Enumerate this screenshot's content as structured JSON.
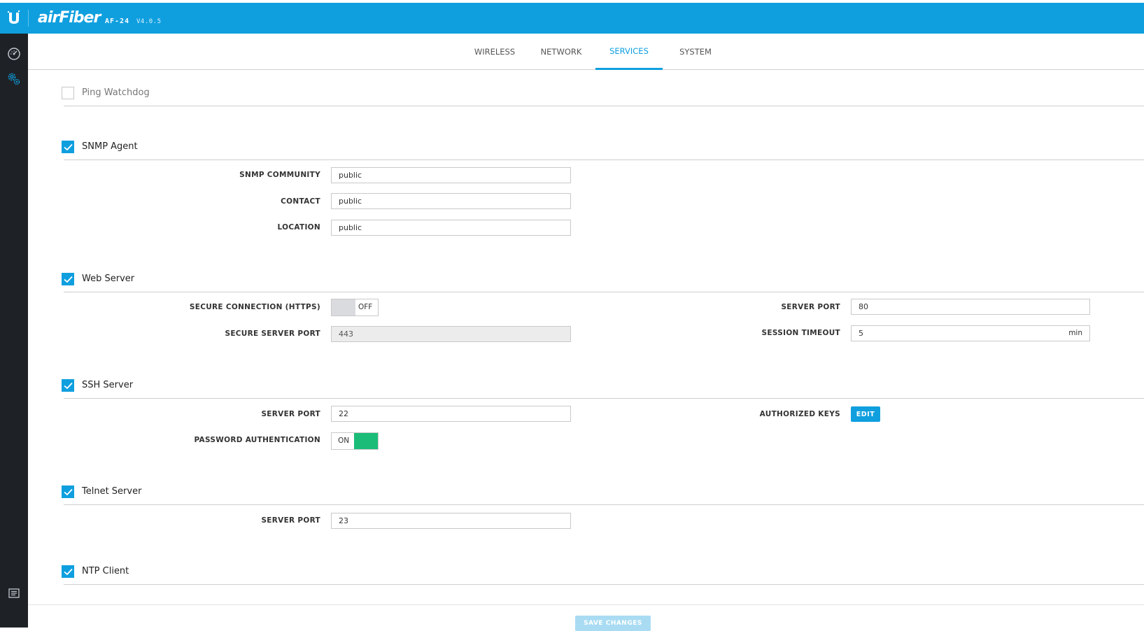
{
  "header": {
    "brand": "airFiber",
    "model": "AF-24",
    "version": "V4.0.5",
    "accent": "#0f9fdf",
    "logo_icon": "ubiquiti-u-icon"
  },
  "sidebar": {
    "items": [
      {
        "name": "dashboard",
        "icon": "dashboard-gauge-icon"
      },
      {
        "name": "settings",
        "icon": "gears-icon"
      },
      {
        "name": "log",
        "icon": "log-list-icon"
      }
    ]
  },
  "tabs": [
    {
      "label": "WIRELESS",
      "active": false
    },
    {
      "label": "NETWORK",
      "active": false
    },
    {
      "label": "SERVICES",
      "active": true
    },
    {
      "label": "SYSTEM",
      "active": false
    }
  ],
  "sections": {
    "ping_watchdog": {
      "title": "Ping Watchdog",
      "checked": false
    },
    "snmp": {
      "title": "SNMP Agent",
      "checked": true,
      "community_label": "SNMP COMMUNITY",
      "community_value": "public",
      "contact_label": "CONTACT",
      "contact_value": "public",
      "location_label": "LOCATION",
      "location_value": "public"
    },
    "web": {
      "title": "Web Server",
      "checked": true,
      "secure_label": "SECURE CONNECTION (HTTPS)",
      "secure_state": "OFF",
      "secure_port_label": "SECURE SERVER PORT",
      "secure_port_value": "443",
      "server_port_label": "SERVER PORT",
      "server_port_value": "80",
      "timeout_label": "SESSION TIMEOUT",
      "timeout_value": "5",
      "timeout_unit": "min"
    },
    "ssh": {
      "title": "SSH Server",
      "checked": true,
      "port_label": "SERVER PORT",
      "port_value": "22",
      "password_label": "PASSWORD AUTHENTICATION",
      "password_state": "ON",
      "keys_label": "AUTHORIZED KEYS",
      "keys_button": "EDIT"
    },
    "telnet": {
      "title": "Telnet Server",
      "checked": true,
      "port_label": "SERVER PORT",
      "port_value": "23"
    },
    "ntp": {
      "title": "NTP Client",
      "checked": true
    }
  },
  "footer": {
    "save_label": "SAVE CHANGES"
  }
}
